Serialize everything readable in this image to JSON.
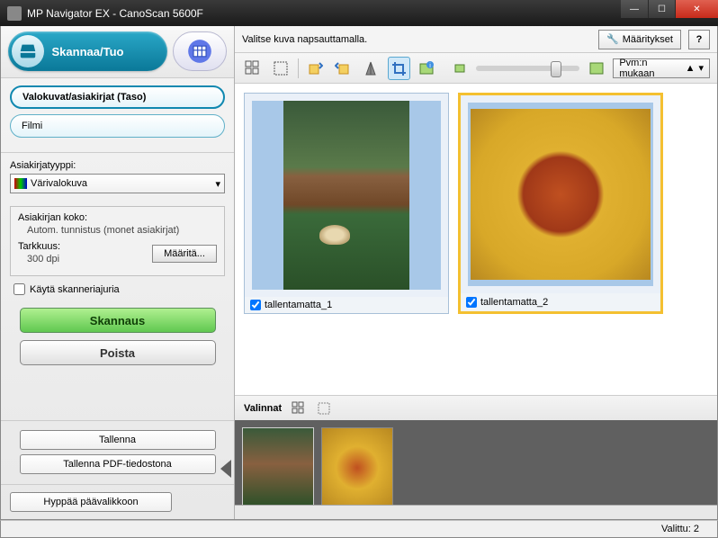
{
  "window": {
    "title": "MP Navigator EX - CanoScan 5600F"
  },
  "header": {
    "scan_tab": "Skannaa/Tuo"
  },
  "sources": {
    "platen": "Valokuvat/asiakirjat (Taso)",
    "film": "Filmi"
  },
  "doc": {
    "type_label": "Asiakirjatyyppi:",
    "type_value": "Värivalokuva",
    "size_label": "Asiakirjan koko:",
    "size_value": "Autom. tunnistus (monet asiakirjat)",
    "res_label": "Tarkkuus:",
    "res_value": "300 dpi",
    "spec_btn": "Määritä...",
    "use_driver": "Käytä skanneriajuria"
  },
  "actions": {
    "scan": "Skannaus",
    "delete": "Poista",
    "save": "Tallenna",
    "save_pdf": "Tallenna PDF-tiedostona",
    "jump": "Hyppää päävalikkoon"
  },
  "topbar": {
    "message": "Valitse kuva napsauttamalla.",
    "settings": "Määritykset",
    "help": "?",
    "sort": "Pvm:n mukaan"
  },
  "thumbs": [
    {
      "caption": "tallentamatta_1",
      "checked": true
    },
    {
      "caption": "tallentamatta_2",
      "checked": true
    }
  ],
  "selection_bar": "Valinnat",
  "status": {
    "selected_label": "Valittu: 2"
  }
}
